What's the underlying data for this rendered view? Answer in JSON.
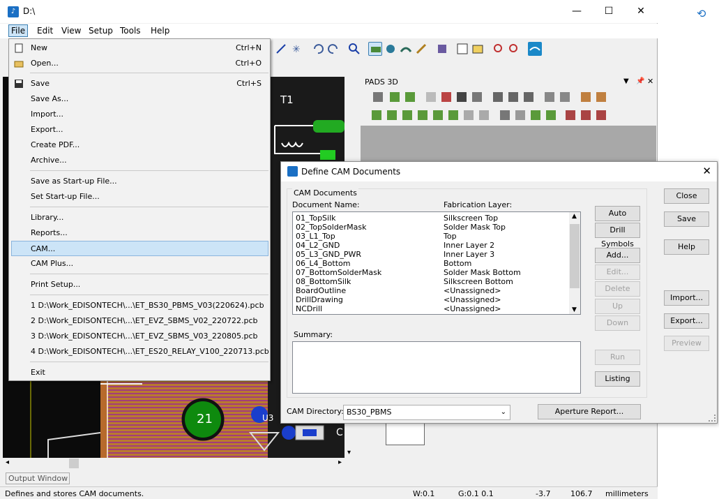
{
  "window": {
    "title": "D:\\",
    "minimize": "—",
    "maximize": "☐",
    "close": "✕"
  },
  "menubar": [
    "File",
    "Edit",
    "View",
    "Setup",
    "Tools",
    "Help"
  ],
  "file_menu": {
    "items": [
      {
        "label": "New",
        "accel": "Ctrl+N"
      },
      {
        "label": "Open...",
        "accel": "Ctrl+O"
      },
      {
        "label": "Save",
        "accel": "Ctrl+S"
      },
      {
        "label": "Save As...",
        "accel": ""
      },
      {
        "label": "Import...",
        "accel": ""
      },
      {
        "label": "Export...",
        "accel": ""
      },
      {
        "label": "Create PDF...",
        "accel": ""
      },
      {
        "label": "Archive...",
        "accel": ""
      },
      {
        "label": "Save as Start-up File...",
        "accel": ""
      },
      {
        "label": "Set Start-up File...",
        "accel": ""
      },
      {
        "label": "Library...",
        "accel": ""
      },
      {
        "label": "Reports...",
        "accel": ""
      },
      {
        "label": "CAM...",
        "accel": ""
      },
      {
        "label": "CAM Plus...",
        "accel": ""
      },
      {
        "label": "Print Setup...",
        "accel": ""
      },
      {
        "label": "1 D:\\Work_EDISONTECH\\...\\ET_BS30_PBMS_V03(220624).pcb",
        "accel": ""
      },
      {
        "label": "2 D:\\Work_EDISONTECH\\...\\ET_EVZ_SBMS_V02_220722.pcb",
        "accel": ""
      },
      {
        "label": "3 D:\\Work_EDISONTECH\\...\\ET_EVZ_SBMS_V03_220805.pcb",
        "accel": ""
      },
      {
        "label": "4 D:\\Work_EDISONTECH\\...\\ET_ES20_RELAY_V100_220713.pcb",
        "accel": ""
      },
      {
        "label": "Exit",
        "accel": ""
      }
    ]
  },
  "pads3d": {
    "title": "PADS 3D"
  },
  "pcb": {
    "labels": [
      "T1",
      "21",
      "U3",
      "C"
    ]
  },
  "dialog": {
    "title": "Define CAM Documents",
    "close": "✕",
    "group_label": "CAM Documents",
    "col_doc": "Document Name:",
    "col_layer": "Fabrication Layer:",
    "rows": [
      {
        "name": "01_TopSilk",
        "layer": "Silkscreen Top"
      },
      {
        "name": "02_TopSolderMask",
        "layer": "Solder Mask Top"
      },
      {
        "name": "03_L1_Top",
        "layer": "Top"
      },
      {
        "name": "04_L2_GND",
        "layer": "Inner Layer 2"
      },
      {
        "name": "05_L3_GND_PWR",
        "layer": " Inner Layer 3"
      },
      {
        "name": "06_L4_Bottom",
        "layer": "Bottom"
      },
      {
        "name": "07_BottomSolderMask",
        "layer": " Solder Mask Bottom"
      },
      {
        "name": "08_BottomSilk",
        "layer": " Silkscreen Bottom"
      },
      {
        "name": "BoardOutline",
        "layer": "<Unassigned>"
      },
      {
        "name": "DrillDrawing",
        "layer": " <Unassigned>"
      },
      {
        "name": "NCDrill",
        "layer": " <Unassigned>"
      }
    ],
    "summary_label": "Summary:",
    "cam_dir_label": "CAM Directory:",
    "cam_dir_value": "BS30_PBMS",
    "buttons": {
      "auto_define": "Auto Define",
      "drill_symbols": "Drill Symbols",
      "add": "Add...",
      "edit": "Edit...",
      "delete": "Delete",
      "up": "Up",
      "down": "Down",
      "run": "Run",
      "listing": "Listing",
      "aperture_report": "Aperture Report...",
      "close": "Close",
      "save": "Save",
      "help": "Help",
      "import": "Import...",
      "export": "Export...",
      "preview": "Preview"
    }
  },
  "output_window": "Output Window",
  "status": {
    "message": "Defines and stores CAM documents.",
    "w": "W:0.1",
    "g": "G:0.1 0.1",
    "x": "-3.7",
    "y": "106.7",
    "units": "millimeters"
  }
}
